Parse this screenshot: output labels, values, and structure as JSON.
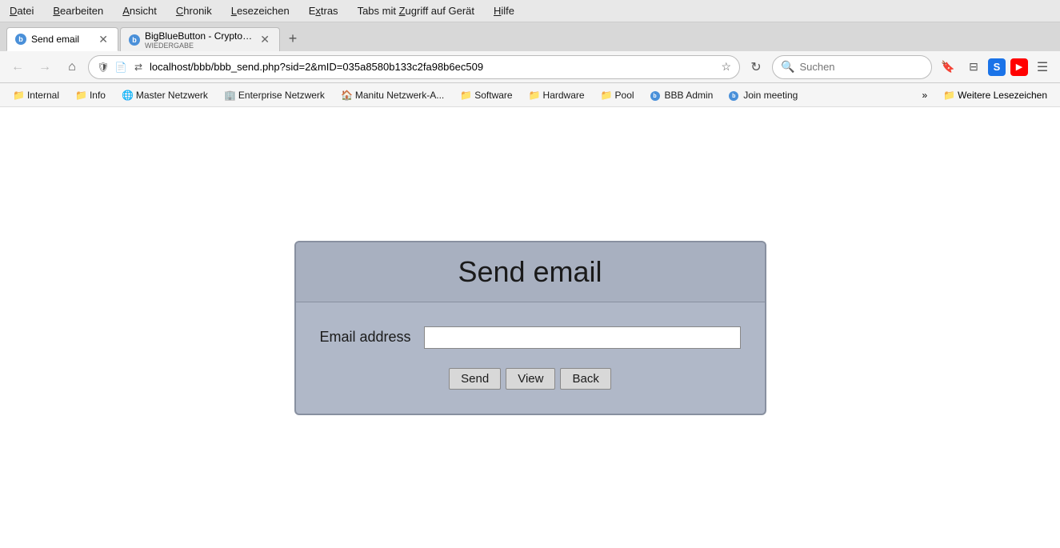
{
  "menu": {
    "items": [
      "Datei",
      "Bearbeiten",
      "Ansicht",
      "Chronik",
      "Lesezeichen",
      "Extras",
      "Tabs mit Zugriff auf Gerät",
      "Hilfe"
    ]
  },
  "tabs": [
    {
      "id": "tab1",
      "label": "Send email",
      "icon_type": "bbb",
      "active": true
    },
    {
      "id": "tab2",
      "label": "BigBlueButton - Crypto-B...",
      "sublabel": "WIEDERGABE",
      "icon_type": "bbb",
      "active": false
    }
  ],
  "nav": {
    "address": "localhost/bbb/bbb_send.php?sid=2&mID=035a8580b133c2fa98b6ec509",
    "search_placeholder": "Suchen"
  },
  "bookmarks": [
    {
      "label": "Internal",
      "icon": "📁"
    },
    {
      "label": "Info",
      "icon": "📁"
    },
    {
      "label": "Master Netzwerk",
      "icon": "🌐"
    },
    {
      "label": "Enterprise Netzwerk",
      "icon": "🏢"
    },
    {
      "label": "Manitu Netzwerk-A...",
      "icon": "🏠"
    },
    {
      "label": "Software",
      "icon": "📁"
    },
    {
      "label": "Hardware",
      "icon": "📁"
    },
    {
      "label": "Pool",
      "icon": "📁"
    },
    {
      "label": "BBB Admin",
      "icon": "bbb"
    },
    {
      "label": "Join meeting",
      "icon": "bbb"
    }
  ],
  "bookmark_more": "»",
  "further_bookmarks_label": "Weitere Lesezeichen",
  "form": {
    "title": "Send email",
    "email_label": "Email address",
    "email_placeholder": "",
    "btn_send": "Send",
    "btn_view": "View",
    "btn_back": "Back"
  }
}
